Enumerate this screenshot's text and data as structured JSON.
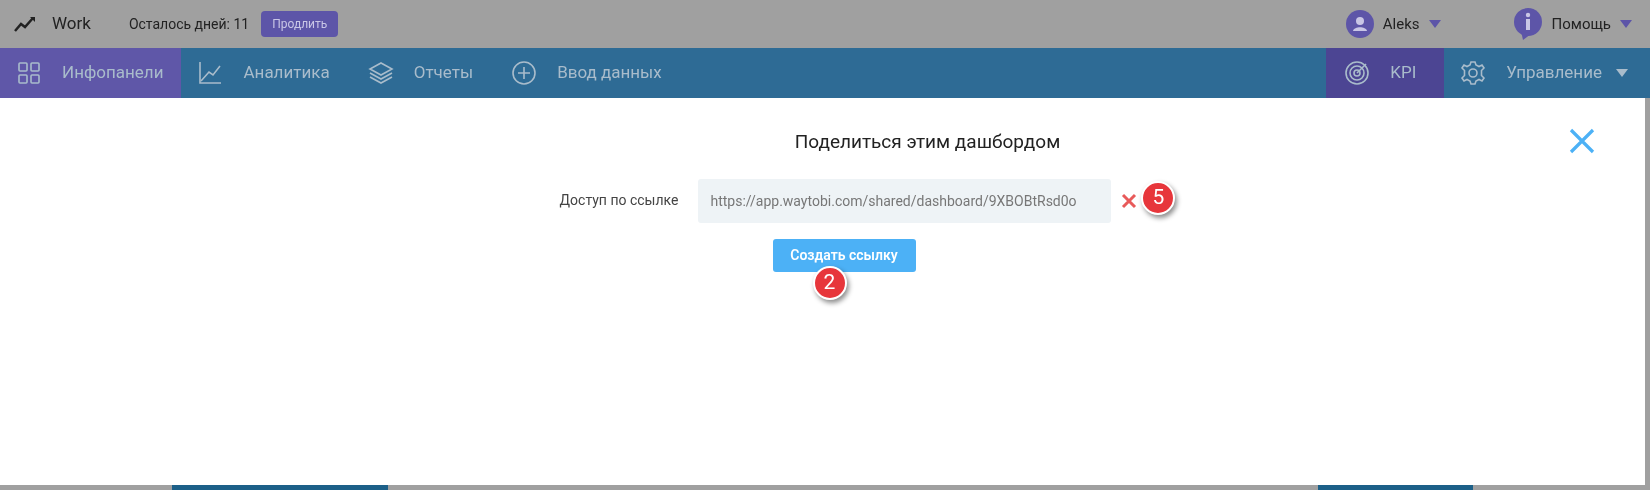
{
  "header": {
    "app_name": "Work",
    "days_left": "Осталось дней: 11",
    "extend_button": "Продлить",
    "user": "Aleks",
    "help": "Помощь"
  },
  "nav": [
    {
      "label": "Инфопанели",
      "selected": true
    },
    {
      "label": "Аналитика",
      "selected": false
    },
    {
      "label": "Отчеты",
      "selected": false
    },
    {
      "label": "Ввод данных",
      "selected": false
    }
  ],
  "nav_right": [
    {
      "label": "KPI",
      "selected": true
    },
    {
      "label": "Управление",
      "selected": false,
      "dropdown": true
    }
  ],
  "dialog": {
    "title": "Поделиться этим дашбордом",
    "field_label": "Доступ по ссылке",
    "link_value": "https://app.waytobi.com/shared/dashboard/9XBOBtRsd0o",
    "create_button": "Создать ссылку"
  },
  "callouts": [
    {
      "number": "5"
    },
    {
      "number": "2"
    }
  ]
}
